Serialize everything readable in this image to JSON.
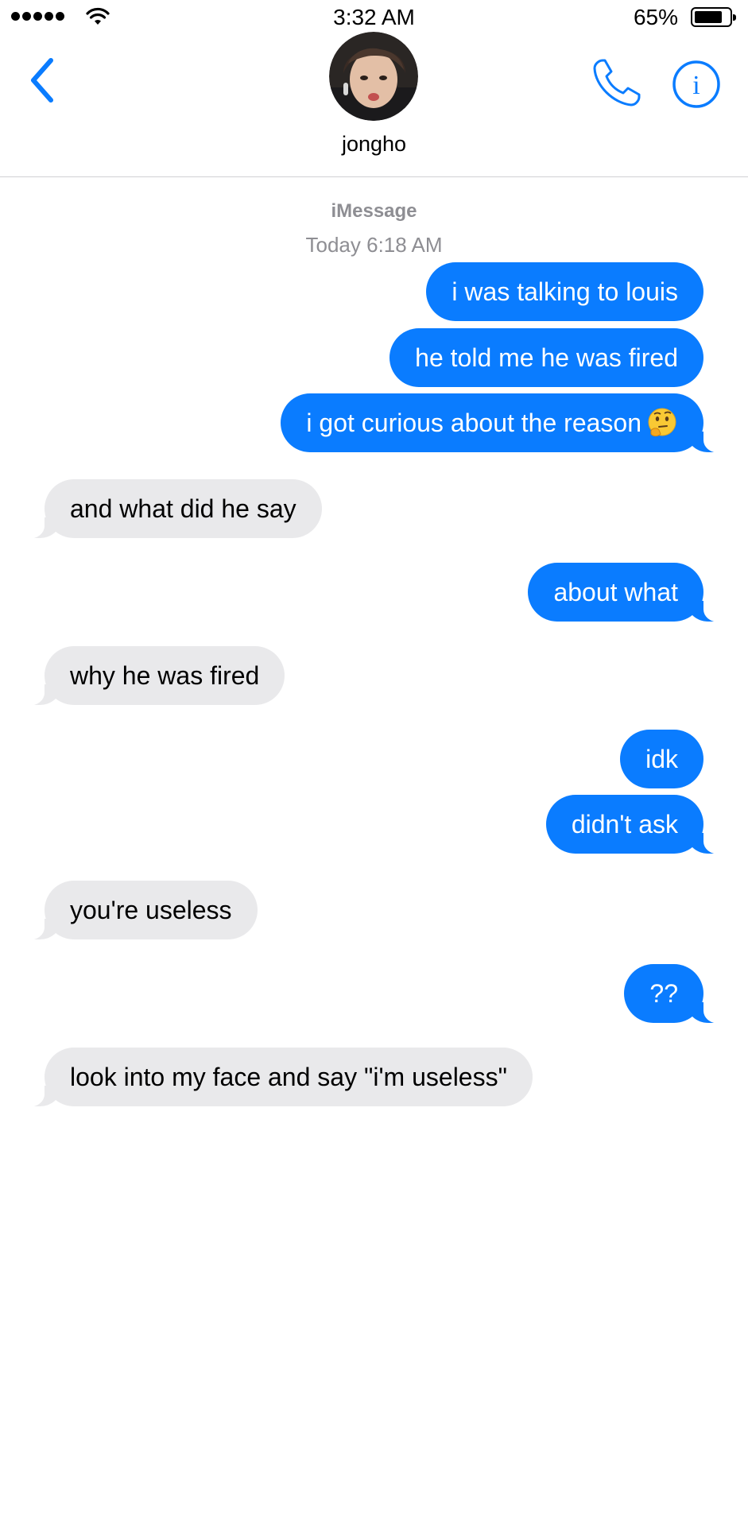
{
  "status_bar": {
    "time": "3:32 AM",
    "battery_percent": "65%",
    "battery_level": 0.65,
    "signal_dots": 5
  },
  "header": {
    "contact_name": "jongho",
    "back_icon": "chevron-left-icon",
    "call_icon": "phone-icon",
    "info_icon": "info-icon",
    "accent_color": "#0a7cff"
  },
  "conversation": {
    "service": "iMessage",
    "timestamp": "Today 6:18 AM",
    "messages": [
      {
        "direction": "outgoing",
        "text": "i was talking to louis"
      },
      {
        "direction": "outgoing",
        "text": "he told me he was fired"
      },
      {
        "direction": "outgoing",
        "text": "i got curious about the reason",
        "emoji": "thinking-face"
      },
      {
        "direction": "incoming",
        "text": "and what did he say"
      },
      {
        "direction": "outgoing",
        "text": "about what"
      },
      {
        "direction": "incoming",
        "text": "why he was fired"
      },
      {
        "direction": "outgoing",
        "text": "idk"
      },
      {
        "direction": "outgoing",
        "text": "didn't ask"
      },
      {
        "direction": "incoming",
        "text": "you're useless"
      },
      {
        "direction": "outgoing",
        "text": "??"
      },
      {
        "direction": "incoming",
        "text": "look into my face and say \"i'm useless\""
      }
    ]
  },
  "colors": {
    "outgoing_bubble": "#0a7cff",
    "incoming_bubble": "#e9e9eb",
    "meta_text": "#8e8e93"
  }
}
